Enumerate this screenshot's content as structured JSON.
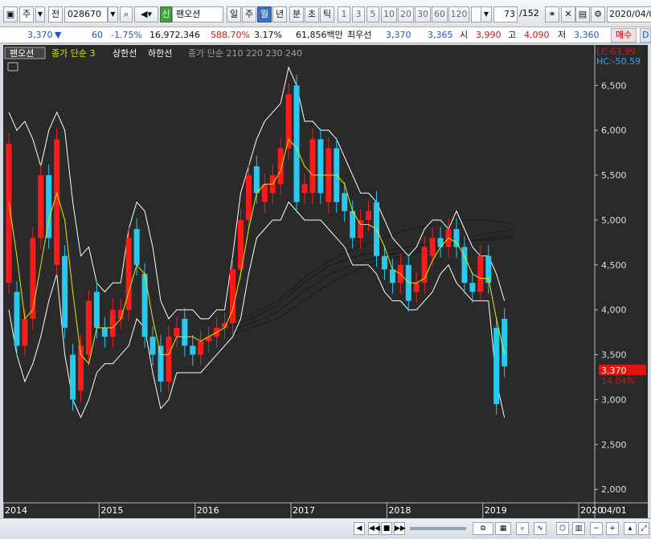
{
  "toolbar": {
    "market": "주",
    "mode": "전",
    "code": "028670",
    "badge": "신",
    "name": "팬오션",
    "periods": [
      "일",
      "주",
      "월",
      "년"
    ],
    "active_period": "월",
    "subs": [
      "분",
      "초",
      "틱"
    ],
    "intervals": [
      "1",
      "3",
      "5",
      "10",
      "20",
      "30",
      "60",
      "120"
    ],
    "count": "73",
    "total": "/152",
    "date": "2020/04/0"
  },
  "quote": {
    "price": "3,370",
    "arrow": "▼",
    "change": "60",
    "change_pct": "-1.75%",
    "volume": "16,972,346",
    "vol_ratio": "588.70%",
    "turnover": "3.17%",
    "amount": "61,856백만",
    "label_low": "최우선",
    "best_ask": "3,370",
    "best_bid": "3,365",
    "open_label": "시",
    "open": "3,990",
    "high_label": "고",
    "high": "4,090",
    "low_label": "저",
    "low": "3,360",
    "buy": "매수",
    "sell": "D"
  },
  "chart_labels": {
    "name_tag": "팬오션",
    "ma_label": "종가 단순 3",
    "upper_label": "상한선",
    "lower_label": "하한선",
    "long_ma_label": "종가 단순 210 220 230 240",
    "lc": "LC:63.99",
    "hc": "HC:-50.59",
    "last_price_tag": "3,370",
    "last_pct": "14.04%",
    "date_end": "04/01"
  },
  "chart_data": {
    "type": "candlestick",
    "ylim": [
      1850,
      6950
    ],
    "yticks": [
      2000,
      2500,
      3000,
      3500,
      4000,
      4500,
      5000,
      5500,
      6000,
      6500
    ],
    "ytick_labels": [
      "2,000",
      "2,500",
      "3,000",
      "3,500",
      "4,000",
      "4,500",
      "5,000",
      "5,500",
      "6,000",
      "6,500"
    ],
    "x_years": [
      "2014",
      "2015",
      "2016",
      "2017",
      "2018",
      "2019",
      "2020"
    ],
    "x_year_index": [
      0,
      12,
      24,
      36,
      48,
      60,
      72
    ],
    "candles": [
      {
        "o": 4300,
        "c": 5850
      },
      {
        "o": 4200,
        "c": 3600
      },
      {
        "o": 3600,
        "c": 3900
      },
      {
        "o": 3900,
        "c": 4800
      },
      {
        "o": 4800,
        "c": 5500
      },
      {
        "o": 5500,
        "c": 4800
      },
      {
        "o": 4500,
        "c": 5900
      },
      {
        "o": 4600,
        "c": 3800
      },
      {
        "o": 3500,
        "c": 3000
      },
      {
        "o": 3100,
        "c": 3600
      },
      {
        "o": 3500,
        "c": 4100
      },
      {
        "o": 4200,
        "c": 3800
      },
      {
        "o": 3800,
        "c": 3700
      },
      {
        "o": 3700,
        "c": 4000
      },
      {
        "o": 3900,
        "c": 4000
      },
      {
        "o": 4000,
        "c": 4800
      },
      {
        "o": 4900,
        "c": 4500
      },
      {
        "o": 4400,
        "c": 3700
      },
      {
        "o": 3700,
        "c": 3500
      },
      {
        "o": 3600,
        "c": 3200
      },
      {
        "o": 3200,
        "c": 3700
      },
      {
        "o": 3700,
        "c": 3800
      },
      {
        "o": 3900,
        "c": 3600
      },
      {
        "o": 3600,
        "c": 3500
      },
      {
        "o": 3500,
        "c": 3650
      },
      {
        "o": 3650,
        "c": 3700
      },
      {
        "o": 3700,
        "c": 3800
      },
      {
        "o": 3800,
        "c": 3850
      },
      {
        "o": 3850,
        "c": 4450
      },
      {
        "o": 4450,
        "c": 5000
      },
      {
        "o": 5000,
        "c": 5500
      },
      {
        "o": 5600,
        "c": 5300
      },
      {
        "o": 5200,
        "c": 5400
      },
      {
        "o": 5300,
        "c": 5500
      },
      {
        "o": 5400,
        "c": 5800
      },
      {
        "o": 5800,
        "c": 6400
      },
      {
        "o": 6500,
        "c": 5200
      },
      {
        "o": 5300,
        "c": 5400
      },
      {
        "o": 5300,
        "c": 5900
      },
      {
        "o": 5900,
        "c": 5300
      },
      {
        "o": 5200,
        "c": 5800
      },
      {
        "o": 5800,
        "c": 5200
      },
      {
        "o": 5300,
        "c": 5100
      },
      {
        "o": 5100,
        "c": 4800
      },
      {
        "o": 4800,
        "c": 5000
      },
      {
        "o": 5000,
        "c": 5100
      },
      {
        "o": 5200,
        "c": 4600
      },
      {
        "o": 4600,
        "c": 4450
      },
      {
        "o": 4450,
        "c": 4300
      },
      {
        "o": 4300,
        "c": 4500
      },
      {
        "o": 4500,
        "c": 4100
      },
      {
        "o": 4200,
        "c": 4300
      },
      {
        "o": 4300,
        "c": 4700
      },
      {
        "o": 4600,
        "c": 4800
      },
      {
        "o": 4800,
        "c": 4700
      },
      {
        "o": 4700,
        "c": 4900
      },
      {
        "o": 4900,
        "c": 4700
      },
      {
        "o": 4700,
        "c": 4300
      },
      {
        "o": 4300,
        "c": 4200
      },
      {
        "o": 4200,
        "c": 4600
      },
      {
        "o": 4600,
        "c": 4300
      },
      {
        "o": 3800,
        "c": 2950
      },
      {
        "o": 3900,
        "c": 3370
      }
    ],
    "ma3": [
      5200,
      4600,
      3900,
      4000,
      4500,
      5000,
      5300,
      5000,
      4200,
      3500,
      3400,
      3800,
      3800,
      3800,
      3900,
      4200,
      4500,
      4400,
      3900,
      3500,
      3500,
      3700,
      3700,
      3700,
      3650,
      3700,
      3750,
      3800,
      4000,
      4400,
      4900,
      5300,
      5400,
      5400,
      5550,
      5900,
      5800,
      5600,
      5500,
      5500,
      5500,
      5500,
      5400,
      5100,
      4950,
      4950,
      4900,
      4700,
      4450,
      4400,
      4300,
      4300,
      4350,
      4550,
      4700,
      4800,
      4750,
      4600,
      4400,
      4350,
      4350,
      3900,
      3500
    ],
    "upper": [
      6200,
      6000,
      6100,
      5900,
      5600,
      6000,
      6200,
      6000,
      5200,
      4600,
      4700,
      4300,
      4200,
      4300,
      4300,
      4900,
      5200,
      5100,
      4700,
      4100,
      3900,
      4000,
      4000,
      4000,
      3900,
      3900,
      4000,
      4000,
      4600,
      5300,
      5600,
      5900,
      6100,
      6200,
      6300,
      6700,
      6500,
      6100,
      6100,
      6000,
      6000,
      5900,
      5700,
      5500,
      5300,
      5300,
      5200,
      5000,
      4800,
      4700,
      4600,
      4700,
      4900,
      5000,
      5000,
      4900,
      5100,
      4900,
      4700,
      4600,
      4600,
      4400,
      4100
    ],
    "lower": [
      4000,
      3500,
      3200,
      3400,
      3700,
      4100,
      4400,
      3500,
      3000,
      2800,
      3000,
      3300,
      3400,
      3400,
      3500,
      3600,
      3900,
      3800,
      3300,
      2900,
      3000,
      3300,
      3300,
      3300,
      3300,
      3400,
      3500,
      3600,
      3700,
      3900,
      4400,
      4800,
      4900,
      5000,
      5000,
      5200,
      5100,
      5000,
      5000,
      5000,
      4900,
      4800,
      4700,
      4500,
      4500,
      4500,
      4400,
      4200,
      4100,
      4100,
      4000,
      4000,
      4100,
      4200,
      4400,
      4500,
      4300,
      4200,
      4100,
      4100,
      4100,
      3200,
      2800
    ]
  }
}
